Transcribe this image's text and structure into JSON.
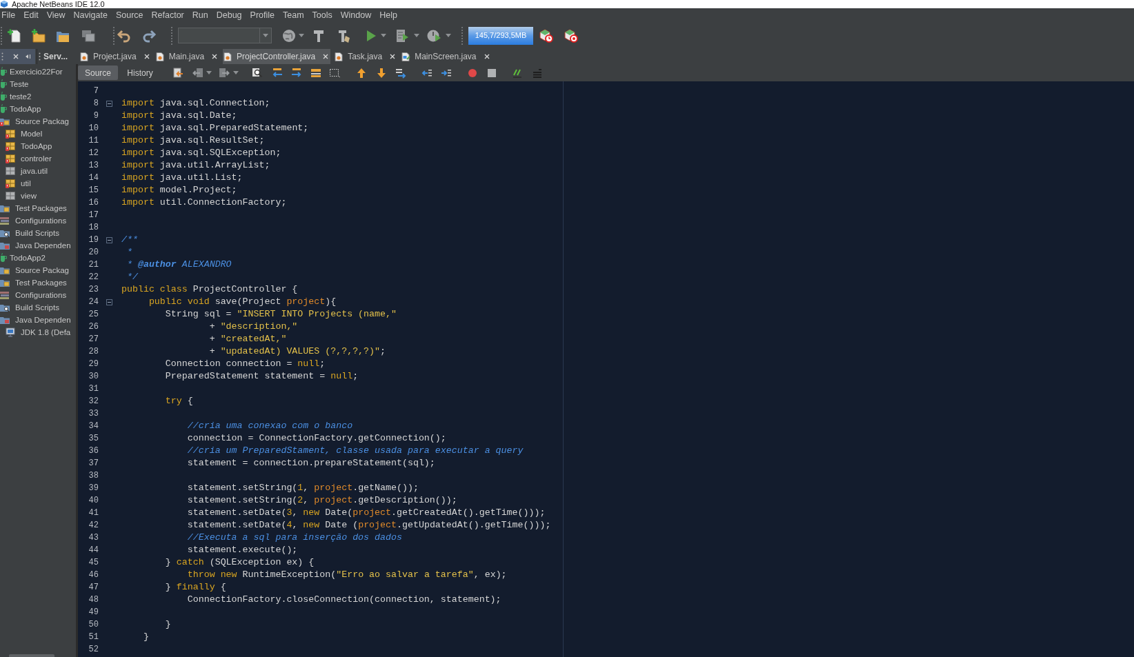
{
  "window": {
    "title": "Apache NetBeans IDE 12.0"
  },
  "menu": [
    "File",
    "Edit",
    "View",
    "Navigate",
    "Source",
    "Refactor",
    "Run",
    "Debug",
    "Profile",
    "Team",
    "Tools",
    "Window",
    "Help"
  ],
  "toolbar": {
    "memory": "145,7/293,5MB"
  },
  "panel_tabs": [
    {
      "selected": true
    },
    {
      "label": "Serv...",
      "selected": false
    }
  ],
  "editor_tabs": [
    {
      "label": "Project.java",
      "kind": "java",
      "selected": false
    },
    {
      "label": "Main.java",
      "kind": "java",
      "selected": false
    },
    {
      "label": "ProjectController.java",
      "kind": "java",
      "selected": true
    },
    {
      "label": "Task.java",
      "kind": "java",
      "selected": false
    },
    {
      "label": "MainScreen.java",
      "kind": "form",
      "selected": false
    }
  ],
  "editor_views": [
    {
      "label": "Source",
      "selected": true
    },
    {
      "label": "History",
      "selected": false
    }
  ],
  "project_tree": [
    {
      "label": "Exercicio22For",
      "kind": "project",
      "error": false
    },
    {
      "label": "Teste",
      "kind": "project",
      "error": false
    },
    {
      "label": "teste2",
      "kind": "project",
      "error": false
    },
    {
      "label": "TodoApp",
      "kind": "project",
      "error": false,
      "children": [
        {
          "label": "Source Packag",
          "kind": "source_packages",
          "error": true,
          "children": [
            {
              "label": "Model",
              "kind": "package",
              "error": true
            },
            {
              "label": "TodoApp",
              "kind": "package",
              "error": true
            },
            {
              "label": "controler",
              "kind": "package",
              "error": true
            },
            {
              "label": "java.util",
              "kind": "empty_package",
              "error": false
            },
            {
              "label": "util",
              "kind": "package",
              "error": true
            },
            {
              "label": "view",
              "kind": "empty_package",
              "error": false
            }
          ]
        },
        {
          "label": "Test Packages",
          "kind": "test_packages",
          "error": false
        },
        {
          "label": "Configurations",
          "kind": "configurations",
          "error": false
        },
        {
          "label": "Build Scripts",
          "kind": "build_scripts",
          "error": false
        },
        {
          "label": "Java Dependen",
          "kind": "dependencies",
          "error": false
        }
      ]
    },
    {
      "label": "TodoApp2",
      "kind": "project",
      "error": false,
      "children": [
        {
          "label": "Source Packag",
          "kind": "source_packages",
          "error": false
        },
        {
          "label": "Test Packages",
          "kind": "test_packages",
          "error": false
        },
        {
          "label": "Configurations",
          "kind": "configurations",
          "error": false
        },
        {
          "label": "Build Scripts",
          "kind": "build_scripts",
          "error": false
        },
        {
          "label": "Java Dependen",
          "kind": "dependencies",
          "error": false,
          "children": [
            {
              "label": "JDK 1.8 (Defa",
              "kind": "jdk",
              "error": false
            }
          ]
        }
      ]
    }
  ],
  "editor": {
    "lines": [
      {
        "number": "7"
      },
      {
        "number": "8",
        "expanded": true,
        "tokens": [
          {
            "kind": "keyword",
            "text": "import"
          },
          {
            "kind": "plain",
            "text": " java.sql.Connection;"
          }
        ]
      },
      {
        "number": "9",
        "tokens": [
          {
            "kind": "keyword",
            "text": "import"
          },
          {
            "kind": "plain",
            "text": " java.sql.Date;"
          }
        ]
      },
      {
        "number": "10",
        "tokens": [
          {
            "kind": "keyword",
            "text": "import"
          },
          {
            "kind": "plain",
            "text": " java.sql.PreparedStatement;"
          }
        ]
      },
      {
        "number": "11",
        "tokens": [
          {
            "kind": "keyword",
            "text": "import"
          },
          {
            "kind": "plain",
            "text": " java.sql.ResultSet;"
          }
        ]
      },
      {
        "number": "12",
        "tokens": [
          {
            "kind": "keyword",
            "text": "import"
          },
          {
            "kind": "plain",
            "text": " java.sql.SQLException;"
          }
        ]
      },
      {
        "number": "13",
        "tokens": [
          {
            "kind": "keyword",
            "text": "import"
          },
          {
            "kind": "plain",
            "text": " java.util.ArrayList;"
          }
        ]
      },
      {
        "number": "14",
        "tokens": [
          {
            "kind": "keyword",
            "text": "import"
          },
          {
            "kind": "plain",
            "text": " java.util.List;"
          }
        ]
      },
      {
        "number": "15",
        "tokens": [
          {
            "kind": "keyword",
            "text": "import"
          },
          {
            "kind": "plain",
            "text": " model.Project;"
          }
        ]
      },
      {
        "number": "16",
        "tokens": [
          {
            "kind": "keyword",
            "text": "import"
          },
          {
            "kind": "plain",
            "text": " util.ConnectionFactory;"
          }
        ]
      },
      {
        "number": "17"
      },
      {
        "number": "18"
      },
      {
        "number": "19",
        "expanded": true,
        "tokens": [
          {
            "kind": "doc",
            "text": "/**"
          }
        ]
      },
      {
        "number": "20",
        "tokens": [
          {
            "kind": "doc",
            "text": " *"
          }
        ]
      },
      {
        "number": "21",
        "tokens": [
          {
            "kind": "doc",
            "text": " * "
          },
          {
            "kind": "doc_tag",
            "text": "@author"
          },
          {
            "kind": "doc",
            "text": " ALEXANDRO"
          }
        ]
      },
      {
        "number": "22",
        "tokens": [
          {
            "kind": "doc",
            "text": " */"
          }
        ]
      },
      {
        "number": "23",
        "tokens": [
          {
            "kind": "keyword",
            "text": "public class"
          },
          {
            "kind": "plain",
            "text": " ProjectController {"
          }
        ]
      },
      {
        "number": "24",
        "expanded": true,
        "tokens": [
          {
            "kind": "keyword",
            "text": "     public void"
          },
          {
            "kind": "plain",
            "text": " save(Project "
          },
          {
            "kind": "param",
            "text": "project"
          },
          {
            "kind": "plain",
            "text": "){"
          }
        ]
      },
      {
        "number": "25",
        "tokens": [
          {
            "kind": "plain",
            "text": "        String sql = "
          },
          {
            "kind": "string",
            "text": "\"INSERT INTO Projects (name,\""
          }
        ]
      },
      {
        "number": "26",
        "tokens": [
          {
            "kind": "plain",
            "text": "                + "
          },
          {
            "kind": "string",
            "text": "\"description,\""
          }
        ]
      },
      {
        "number": "27",
        "tokens": [
          {
            "kind": "plain",
            "text": "                + "
          },
          {
            "kind": "string",
            "text": "\"createdAt,\""
          }
        ]
      },
      {
        "number": "28",
        "tokens": [
          {
            "kind": "plain",
            "text": "                + "
          },
          {
            "kind": "string",
            "text": "\"updatedAt) VALUES (?,?,?,?)\""
          },
          {
            "kind": "plain",
            "text": ";"
          }
        ]
      },
      {
        "number": "29",
        "tokens": [
          {
            "kind": "plain",
            "text": "        Connection connection = "
          },
          {
            "kind": "keyword",
            "text": "null"
          },
          {
            "kind": "plain",
            "text": ";"
          }
        ]
      },
      {
        "number": "30",
        "tokens": [
          {
            "kind": "plain",
            "text": "        PreparedStatement statement = "
          },
          {
            "kind": "keyword",
            "text": "null"
          },
          {
            "kind": "plain",
            "text": ";"
          }
        ]
      },
      {
        "number": "31"
      },
      {
        "number": "32",
        "tokens": [
          {
            "kind": "keyword",
            "text": "        try"
          },
          {
            "kind": "plain",
            "text": " {"
          }
        ]
      },
      {
        "number": "33"
      },
      {
        "number": "34",
        "tokens": [
          {
            "kind": "comment",
            "text": "            //cria uma conexao com o banco"
          }
        ]
      },
      {
        "number": "35",
        "tokens": [
          {
            "kind": "plain",
            "text": "            connection = ConnectionFactory.getConnection();"
          }
        ]
      },
      {
        "number": "36",
        "tokens": [
          {
            "kind": "comment",
            "text": "            //cria um PreparedStament, classe usada para executar a query"
          }
        ]
      },
      {
        "number": "37",
        "tokens": [
          {
            "kind": "plain",
            "text": "            statement = connection.prepareStatement(sql);"
          }
        ]
      },
      {
        "number": "38"
      },
      {
        "number": "39",
        "tokens": [
          {
            "kind": "plain",
            "text": "            statement.setString("
          },
          {
            "kind": "number",
            "text": "1"
          },
          {
            "kind": "plain",
            "text": ", "
          },
          {
            "kind": "param",
            "text": "project"
          },
          {
            "kind": "plain",
            "text": ".getName());"
          }
        ]
      },
      {
        "number": "40",
        "tokens": [
          {
            "kind": "plain",
            "text": "            statement.setString("
          },
          {
            "kind": "number",
            "text": "2"
          },
          {
            "kind": "plain",
            "text": ", "
          },
          {
            "kind": "param",
            "text": "project"
          },
          {
            "kind": "plain",
            "text": ".getDescription());"
          }
        ]
      },
      {
        "number": "41",
        "tokens": [
          {
            "kind": "plain",
            "text": "            statement.setDate("
          },
          {
            "kind": "number",
            "text": "3"
          },
          {
            "kind": "plain",
            "text": ", "
          },
          {
            "kind": "keyword",
            "text": "new"
          },
          {
            "kind": "plain",
            "text": " Date("
          },
          {
            "kind": "param",
            "text": "project"
          },
          {
            "kind": "plain",
            "text": ".getCreatedAt().getTime()));"
          }
        ]
      },
      {
        "number": "42",
        "tokens": [
          {
            "kind": "plain",
            "text": "            statement.setDate("
          },
          {
            "kind": "number",
            "text": "4"
          },
          {
            "kind": "plain",
            "text": ", "
          },
          {
            "kind": "keyword",
            "text": "new"
          },
          {
            "kind": "plain",
            "text": " Date ("
          },
          {
            "kind": "param",
            "text": "project"
          },
          {
            "kind": "plain",
            "text": ".getUpdatedAt().getTime()));"
          }
        ]
      },
      {
        "number": "43",
        "tokens": [
          {
            "kind": "comment",
            "text": "            //Executa a sql para inserção dos dados"
          }
        ]
      },
      {
        "number": "44",
        "tokens": [
          {
            "kind": "plain",
            "text": "            statement.execute();"
          }
        ]
      },
      {
        "number": "45",
        "tokens": [
          {
            "kind": "plain",
            "text": "        } "
          },
          {
            "kind": "keyword",
            "text": "catch"
          },
          {
            "kind": "plain",
            "text": " (SQLException ex) {"
          }
        ]
      },
      {
        "number": "46",
        "tokens": [
          {
            "kind": "keyword",
            "text": "            throw new"
          },
          {
            "kind": "plain",
            "text": " RuntimeException("
          },
          {
            "kind": "string",
            "text": "\"Erro ao salvar a tarefa\""
          },
          {
            "kind": "plain",
            "text": ", ex);"
          }
        ]
      },
      {
        "number": "47",
        "tokens": [
          {
            "kind": "plain",
            "text": "        } "
          },
          {
            "kind": "keyword",
            "text": "finally"
          },
          {
            "kind": "plain",
            "text": " {"
          }
        ]
      },
      {
        "number": "48",
        "tokens": [
          {
            "kind": "plain",
            "text": "            ConnectionFactory.closeConnection(connection, statement);"
          }
        ]
      },
      {
        "number": "49"
      },
      {
        "number": "50",
        "tokens": [
          {
            "kind": "plain",
            "text": "        }"
          }
        ]
      },
      {
        "number": "51",
        "tokens": [
          {
            "kind": "plain",
            "text": "    }"
          }
        ]
      },
      {
        "number": "52"
      }
    ]
  }
}
